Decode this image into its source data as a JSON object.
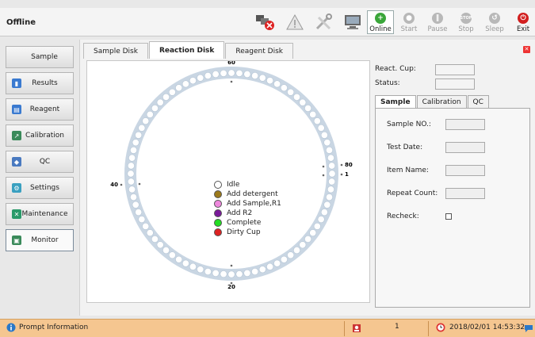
{
  "header": {
    "status": "Offline",
    "toolbar": [
      {
        "label": "Online",
        "icon": "plus-icon",
        "state": "active",
        "color": "#3aa63a"
      },
      {
        "label": "Start",
        "icon": "play-icon",
        "state": "disabled"
      },
      {
        "label": "Pause",
        "icon": "pause-icon",
        "state": "disabled"
      },
      {
        "label": "Stop",
        "icon": "stop-icon",
        "state": "disabled",
        "glyph": "STOP"
      },
      {
        "label": "Sleep",
        "icon": "sleep-icon",
        "state": "disabled"
      },
      {
        "label": "Exit",
        "icon": "power-icon",
        "state": "enabled",
        "color": "#d21f1f"
      }
    ]
  },
  "sidebar": {
    "items": [
      {
        "label": "Sample",
        "icon": "sample-icon"
      },
      {
        "label": "Results",
        "icon": "results-icon"
      },
      {
        "label": "Reagent",
        "icon": "reagent-icon"
      },
      {
        "label": "Calibration",
        "icon": "calibration-icon"
      },
      {
        "label": "QC",
        "icon": "qc-icon"
      },
      {
        "label": "Settings",
        "icon": "settings-icon"
      },
      {
        "label": "Maintenance",
        "icon": "maintenance-icon"
      },
      {
        "label": "Monitor",
        "icon": "monitor-icon",
        "active": true
      }
    ]
  },
  "main": {
    "tabs": [
      "Sample Disk",
      "Reaction Disk",
      "Reagent Disk"
    ],
    "active_tab": "Reaction Disk",
    "disk_labels": {
      "top": "60",
      "right": "80",
      "right_near": "1",
      "left": "40",
      "bottom": "20"
    },
    "legend": [
      {
        "label": "Idle",
        "color": "#ffffff"
      },
      {
        "label": "Add detergent",
        "color": "#9c7a1a"
      },
      {
        "label": "Add Sample,R1",
        "color": "#ee88dd"
      },
      {
        "label": "Add R2",
        "color": "#7a1a9a"
      },
      {
        "label": "Complete",
        "color": "#22dd22"
      },
      {
        "label": "Dirty Cup",
        "color": "#dd2222"
      }
    ]
  },
  "right_panel": {
    "react_cup_label": "React. Cup:",
    "status_label": "Status:",
    "subtabs": [
      "Sample",
      "Calibration",
      "QC"
    ],
    "active_subtab": "Sample",
    "fields": {
      "sample_no": "Sample NO.:",
      "test_date": "Test Date:",
      "item_name": "Item Name:",
      "repeat_count": "Repeat Count:",
      "recheck": "Recheck:"
    }
  },
  "statusbar": {
    "prompt": "Prompt Information",
    "user_count": "1",
    "datetime": "2018/02/01 14:53:32"
  }
}
